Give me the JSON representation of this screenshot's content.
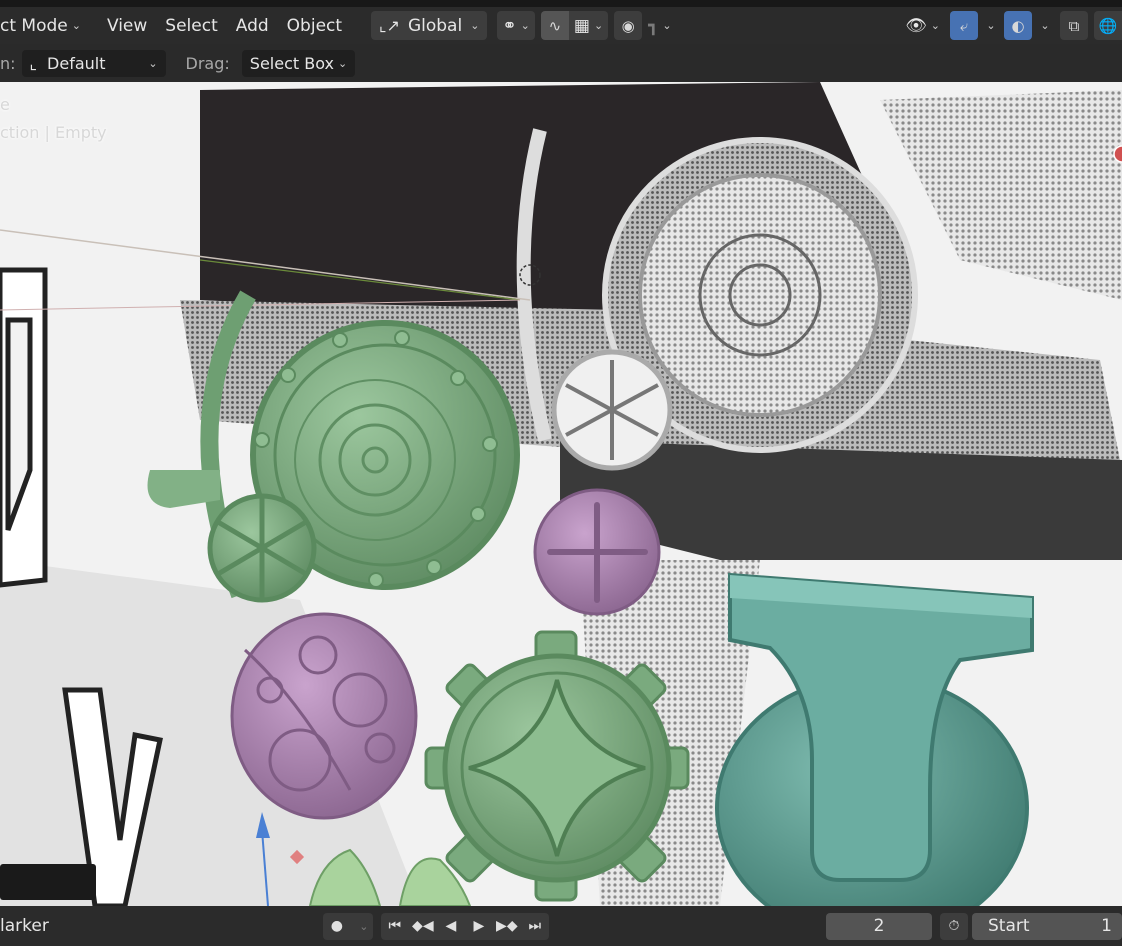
{
  "header": {
    "mode_label": "ct Mode",
    "menus": [
      "View",
      "Select",
      "Add",
      "Object"
    ],
    "transform_orientation": "Global"
  },
  "tool_settings": {
    "orientation_label": "n:",
    "orientation_value": "Default",
    "drag_label": "Drag:",
    "drag_value": "Select Box"
  },
  "viewport": {
    "overlay_line1": "e",
    "overlay_line2": "ction | Empty"
  },
  "timeline": {
    "marker_label": "larker",
    "current_frame": "2",
    "start_label": "Start",
    "start_value": "1"
  },
  "colors": {
    "header_bg": "#2b2b2b",
    "accent_blue": "#4772b3",
    "green_model": "#7fae82",
    "purple_model": "#b087b5",
    "teal_model": "#5f9f94"
  }
}
